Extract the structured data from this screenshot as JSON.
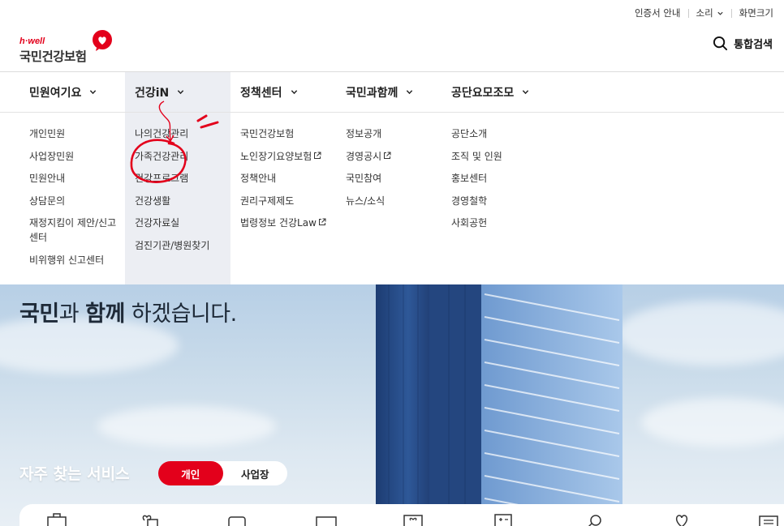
{
  "utility": {
    "cert_info": "인증서 안내",
    "sound": "소리",
    "zoom": "화면크기"
  },
  "logo": {
    "brand": "h·well",
    "name": "국민건강보험"
  },
  "search": {
    "label": "통합검색",
    "icon": "search-icon"
  },
  "gnb": [
    {
      "label": "민원여기요"
    },
    {
      "label": "건강iN",
      "active": true
    },
    {
      "label": "정책센터"
    },
    {
      "label": "국민과함께"
    },
    {
      "label": "공단요모조모"
    }
  ],
  "dropdown": [
    {
      "items": [
        {
          "label": "개인민원"
        },
        {
          "label": "사업장민원"
        },
        {
          "label": "민원안내"
        },
        {
          "label": "상담문의"
        },
        {
          "label": "재정지킴이 제안/신고센터"
        },
        {
          "label": "비위행위 신고센터"
        }
      ]
    },
    {
      "items": [
        {
          "label": "나의건강관리"
        },
        {
          "label": "가족건강관리"
        },
        {
          "label": "건강프로그램"
        },
        {
          "label": "건강생활"
        },
        {
          "label": "건강자료실"
        },
        {
          "label": "검진기관/병원찾기"
        }
      ]
    },
    {
      "items": [
        {
          "label": "국민건강보험"
        },
        {
          "label": "노인장기요양보험",
          "external": true
        },
        {
          "label": "정책안내"
        },
        {
          "label": "권리구제제도"
        },
        {
          "label": "법령정보 건강Law",
          "external": true
        }
      ]
    },
    {
      "items": [
        {
          "label": "정보공개"
        },
        {
          "label": "경영공시",
          "external": true
        },
        {
          "label": "국민참여"
        },
        {
          "label": "뉴스/소식"
        }
      ]
    },
    {
      "items": [
        {
          "label": "공단소개"
        },
        {
          "label": "조직 및 인원"
        },
        {
          "label": "홍보센터"
        },
        {
          "label": "경영철학"
        },
        {
          "label": "사회공헌"
        }
      ]
    }
  ],
  "hero": {
    "line2_bold1": "국민",
    "line2_mid": "과 ",
    "line2_bold2": "함께",
    "line2_end": " 하겠습니다."
  },
  "services": {
    "title": "자주 찾는 서비스",
    "tabs": [
      {
        "label": "개인",
        "active": true
      },
      {
        "label": "사업장"
      }
    ]
  },
  "colors": {
    "brand_red": "#e3001b",
    "active_menu_bg": "#eceef3"
  }
}
